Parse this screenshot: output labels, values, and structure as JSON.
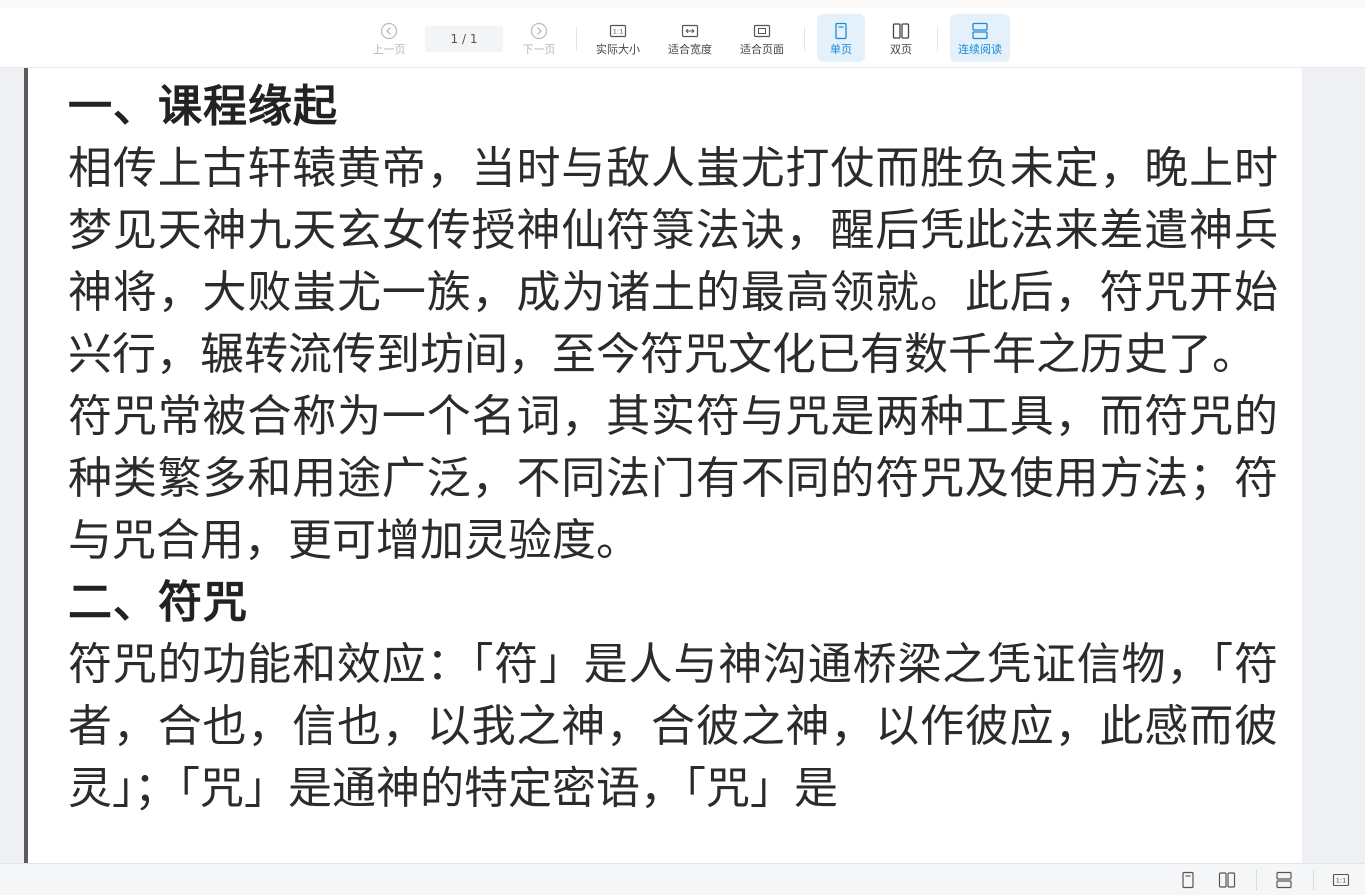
{
  "toolbar": {
    "prev_label": "上一页",
    "page_indicator": "1 / 1",
    "next_label": "下一页",
    "actual_size_label": "实际大小",
    "fit_width_label": "适合宽度",
    "fit_page_label": "适合页面",
    "single_page_label": "单页",
    "double_page_label": "双页",
    "continuous_label": "连续阅读",
    "accent_color": "#1a8ad6"
  },
  "document": {
    "heading1": "一、课程缘起",
    "para1": "相传上古轩辕黄帝，当时与敌人蚩尤打仗而胜负未定，晚上时梦见天神九天玄女传授神仙符箓法诀，醒后凭此法来差遣神兵神将，大败蚩尤一族，成为诸土的最高领就。此后，符咒开始兴行，辗转流传到坊间，至今符咒文化已有数千年之历史了。",
    "para2": "符咒常被合称为一个名词，其实符与咒是两种工具，而符咒的种类繁多和用途广泛，不同法门有不同的符咒及使用方法；符与咒合用，更可增加灵验度。",
    "heading2": "二、符咒",
    "para3": "符咒的功能和效应：「符」是人与神沟通桥梁之凭证信物，「符者，合也，信也，以我之神，合彼之神，以作彼应，此感而彼灵」；「咒」是通神的特定密语，「咒」是"
  },
  "statusbar": {
    "icons": [
      "single-page-icon",
      "double-page-icon",
      "continuous-icon",
      "actual-size-icon"
    ]
  }
}
